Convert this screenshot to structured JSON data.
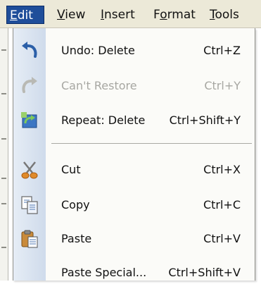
{
  "menubar": {
    "items": [
      {
        "label": "Edit",
        "accel": "E",
        "rest": "dit",
        "active": true
      },
      {
        "label": "View",
        "accel": "V",
        "rest": "iew"
      },
      {
        "label": "Insert",
        "accel": "I",
        "rest": "nsert"
      },
      {
        "label": "Format",
        "pre": "F",
        "accel": "o",
        "rest": "rmat"
      },
      {
        "label": "Tools",
        "accel": "T",
        "rest": "ools"
      }
    ]
  },
  "edit_menu": {
    "items": [
      {
        "label": "Undo: Delete",
        "shortcut": "Ctrl+Z",
        "icon": "undo-icon",
        "enabled": true
      },
      {
        "label": "Can't Restore",
        "shortcut": "Ctrl+Y",
        "icon": "restore-icon",
        "enabled": false
      },
      {
        "label": "Repeat: Delete",
        "shortcut": "Ctrl+Shift+Y",
        "icon": "repeat-icon",
        "enabled": true
      },
      {
        "label": "Cut",
        "shortcut": "Ctrl+X",
        "icon": "scissors-icon",
        "enabled": true
      },
      {
        "label": "Copy",
        "shortcut": "Ctrl+C",
        "icon": "copy-icon",
        "enabled": true
      },
      {
        "label": "Paste",
        "shortcut": "Ctrl+V",
        "icon": "paste-icon",
        "enabled": true
      },
      {
        "label": "Paste Special...",
        "shortcut": "Ctrl+Shift+V",
        "icon": "",
        "enabled": true
      }
    ]
  },
  "colors": {
    "menubar_active_bg": "#1f4e9a",
    "menu_bg": "#fbfbf8",
    "icon_column_bg": "#dbe4f0",
    "disabled_text": "#a7a7a2"
  }
}
